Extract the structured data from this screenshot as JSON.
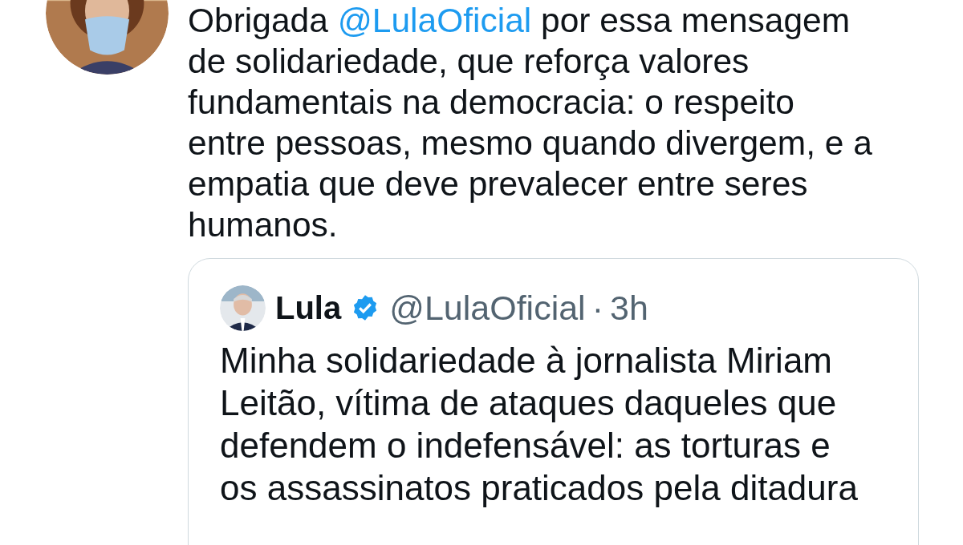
{
  "tweet": {
    "text": [
      {
        "kind": "text",
        "text": "Obrigada "
      },
      {
        "kind": "mention",
        "text": "@LulaOficial"
      },
      {
        "kind": "text",
        "text": " por essa mensagem\nde solidariedade, que reforça valores\nfundamentais na democracia: o respeito\nentre pessoas, mesmo quando divergem, e a\nempatia que deve prevalecer entre seres\nhumanos."
      }
    ],
    "quoted": {
      "name": "Lula",
      "verified": true,
      "handle": "@LulaOficial",
      "separator": "·",
      "time": "3h",
      "text": "Minha solidariedade à jornalista Miriam\nLeitão, vítima de ataques daqueles que\ndefendem o indefensável: as torturas e\nos assassinatos praticados pela ditadura"
    }
  }
}
